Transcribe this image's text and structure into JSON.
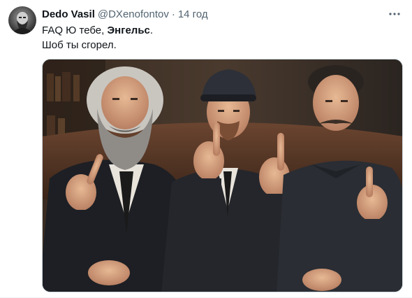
{
  "tweet": {
    "author": {
      "name": "Dedo Vasil",
      "handle": "@DXenofontov",
      "avatar_icon": "bearded-man-avatar"
    },
    "separator": "·",
    "timestamp": "14 год",
    "more_icon": "more-horizontal-icon",
    "text": {
      "line1_prefix": "FAQ Ю тебе, ",
      "line1_bold": "Энгельс",
      "line1_suffix": ".",
      "line2": "Шоб ты сгорел."
    },
    "media": {
      "kind": "photo",
      "subjects": [
        "bald-bearded-elder",
        "man-in-cap",
        "man-with-mustache"
      ]
    }
  },
  "colors": {
    "text_primary": "#0f1419",
    "text_secondary": "#536471",
    "border": "#cfd9de"
  }
}
